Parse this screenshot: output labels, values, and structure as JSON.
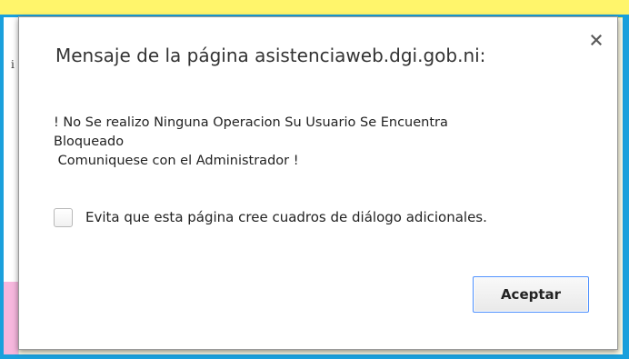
{
  "dialog": {
    "title": "Mensaje de la página asistenciaweb.dgi.gob.ni:",
    "close_icon": "close-icon",
    "message_lines": [
      "! No Se realizo Ninguna Operacion Su Usuario Se Encuentra",
      "Bloqueado",
      " Comuniquese con el Administrador !"
    ],
    "suppress_checkbox": {
      "label": "Evita que esta página cree cuadros de diálogo adicionales.",
      "checked": false
    },
    "accept_label": "Aceptar"
  },
  "colors": {
    "frame_blue": "#1aa0dc",
    "banner_yellow": "#fff56b",
    "focus_ring": "#4d90fe",
    "pink_accent": "#f6b7dd"
  }
}
